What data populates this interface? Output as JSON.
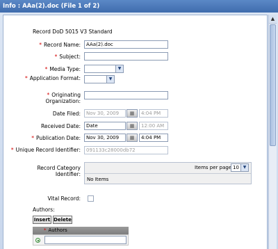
{
  "window": {
    "title": "Info : AAa(2).doc (File 1 of 2)"
  },
  "form": {
    "heading": "Record DoD 5015 V3 Standard",
    "record_name": {
      "label": "Record Name:",
      "value": "AAa(2).doc"
    },
    "subject": {
      "label": "Subject:",
      "value": ""
    },
    "media_type": {
      "label": "Media Type:",
      "value": ""
    },
    "application_format": {
      "label": "Application Format:",
      "value": ""
    },
    "originating_organization": {
      "label": "Originating Organization:",
      "value": ""
    },
    "date_filed": {
      "label": "Date Filed:",
      "date": "Nov 30, 2009",
      "time": "4:04 PM"
    },
    "received_date": {
      "label": "Received Date:",
      "date": "Date",
      "time": "12:00 AM"
    },
    "publication_date": {
      "label": "Publication Date:",
      "date": "Nov 30, 2009",
      "time": "4:04 PM"
    },
    "unique_record_identifier": {
      "label": "Unique Record Identifier:",
      "value": "091133c28000db72"
    },
    "record_category_identifier": {
      "label": "Record Category Identifier:",
      "items_per_page_label": "Items per page:",
      "items_per_page_value": "10",
      "empty_text": "No Items"
    },
    "vital_record": {
      "label": "Vital Record:",
      "checked": false
    },
    "authors": {
      "label": "Authors:",
      "insert_label": "Insert",
      "delete_label": "Delete",
      "column_header": "Authors",
      "row_value": ""
    }
  },
  "required_marker": "*",
  "colors": {
    "title_bar": "#4a78b9",
    "required": "#d40000",
    "panel_border": "#9fb3d1"
  },
  "icons": {
    "dropdown": "chevron-down-icon",
    "calendar": "calendar-icon",
    "scroll_up": "scroll-up-arrow-icon"
  }
}
